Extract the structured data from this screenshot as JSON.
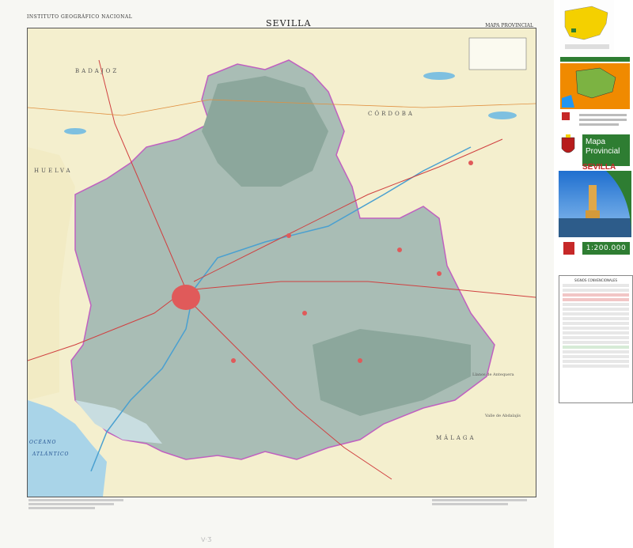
{
  "header": {
    "publisher": "INSTITUTO GEOGRÁFICO NACIONAL",
    "title": "SEVILLA",
    "series": "MAPA PROVINCIAL"
  },
  "map_labels": {
    "province_cordoba": "CÓRDOBA",
    "province_huelva": "HUELVA",
    "province_malaga": "MÁLAGA",
    "province_badajoz": "BADAJOZ",
    "ocean_line1": "OCÉANO",
    "ocean_line2": "ATLÁNTICO",
    "llanos": "Llanos de Antequera",
    "valle": "Valle de Abdalajís"
  },
  "side_panel": {
    "map_title_line1": "Mapa",
    "map_title_line2": "Provincial",
    "province_name": "SEVILLA",
    "scale": "1:200.000",
    "legend_title": "SIGNOS CONVENCIONALES"
  },
  "colors": {
    "sea": "#a9d4e8",
    "land_outside": "#f4efce",
    "relief": "#9fb6ad",
    "province_border": "#c060c0",
    "city": "#e05a5a",
    "accent_green": "#2e7d32",
    "inset_yellow": "#f4d000",
    "inset_orange": "#f08a00"
  },
  "icons": [
    "coat-of-arms-icon",
    "spain-inset-map-icon",
    "torre-del-oro-photo"
  ]
}
